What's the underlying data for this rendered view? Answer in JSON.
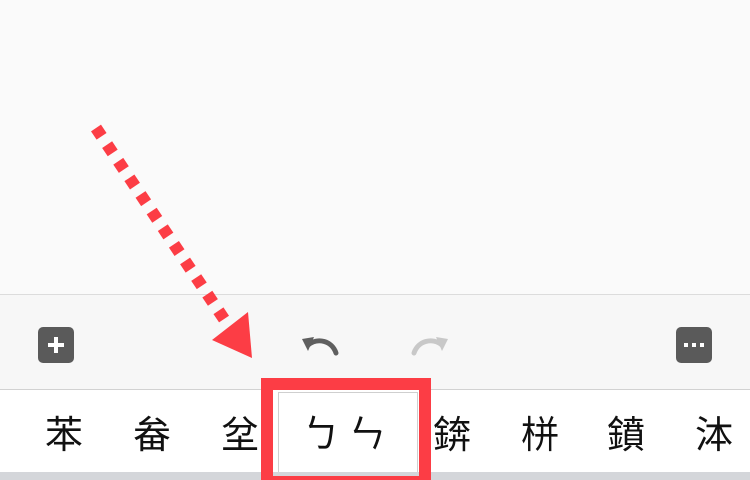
{
  "toolbar": {
    "plus_icon": "plus-icon",
    "undo_icon": "undo-icon",
    "redo_icon": "redo-icon",
    "more_icon": "more-icon"
  },
  "candidates": {
    "items": [
      "苯",
      "畚",
      "坌",
      "ㄅㄣ",
      "錛",
      "栟",
      "鐼",
      "泍"
    ],
    "selected_index": 3
  },
  "annotation": {
    "color": "#fc3d45"
  }
}
